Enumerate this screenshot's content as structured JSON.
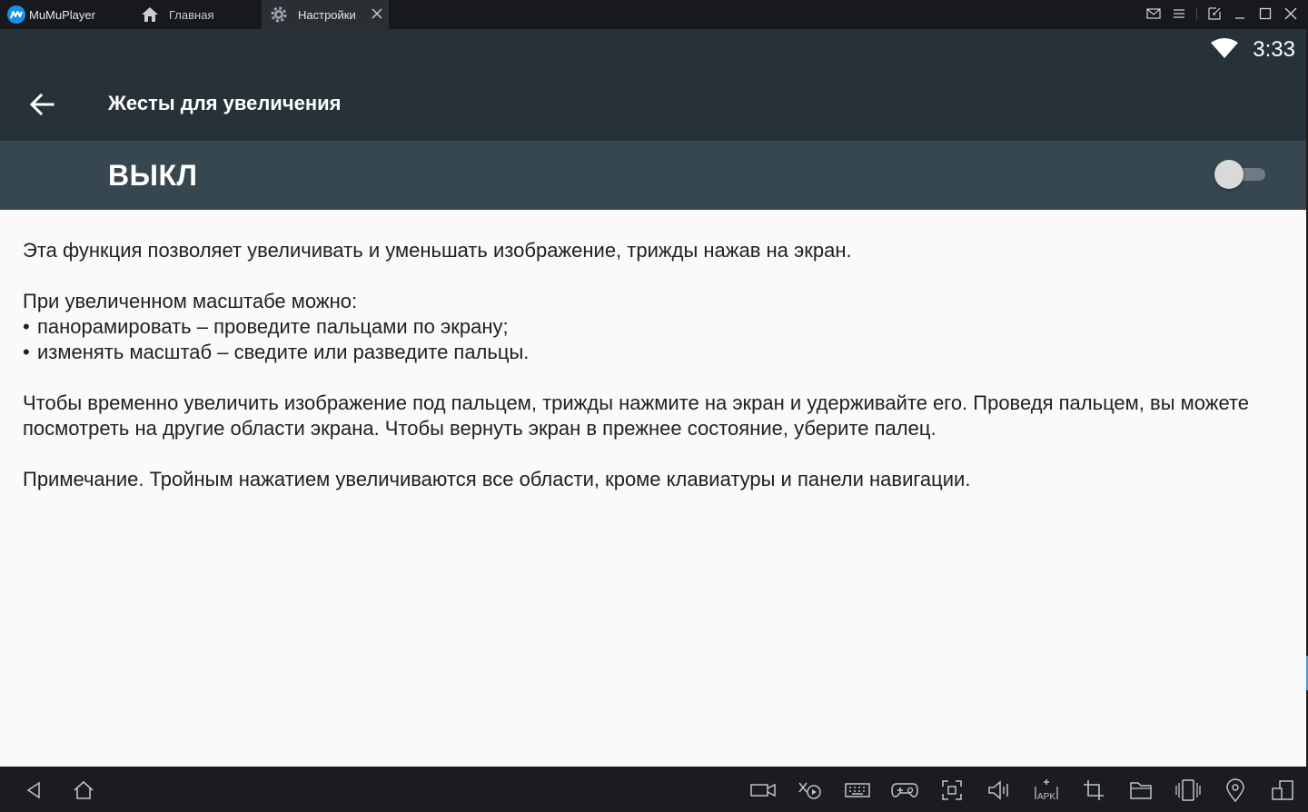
{
  "app": {
    "logo_text": "MuMuPlayer"
  },
  "tabs": [
    {
      "label": "Главная",
      "icon": "home-icon"
    },
    {
      "label": "Настройки",
      "icon": "gear-icon",
      "active": true
    }
  ],
  "status": {
    "time": "3:33"
  },
  "header": {
    "title": "Жесты для увеличения"
  },
  "switch": {
    "label": "ВЫКЛ",
    "checked": false
  },
  "content": {
    "intro": "Эта функция позволяет увеличивать и уменьшать изображение, трижды нажав на экран.",
    "zoom_heading": "При увеличенном масштабе можно:",
    "bullets": [
      "панорамировать – проведите пальцами по экрану;",
      "изменять масштаб – сведите или разведите пальцы."
    ],
    "hold": "Чтобы временно увеличить изображение под пальцем, трижды нажмите на экран и удерживайте его. Проведя пальцем, вы можете посмотреть на другие области экрана. Чтобы вернуть экран в прежнее состояние, уберите палец.",
    "note": "Примечание. Тройным нажатием увеличиваются все области, кроме клавиатуры и панели навигации."
  },
  "colors": {
    "titlebar": "#18191c",
    "statusbar": "#263238",
    "switchbar": "#37474f",
    "accent": "#1a8fe8"
  }
}
